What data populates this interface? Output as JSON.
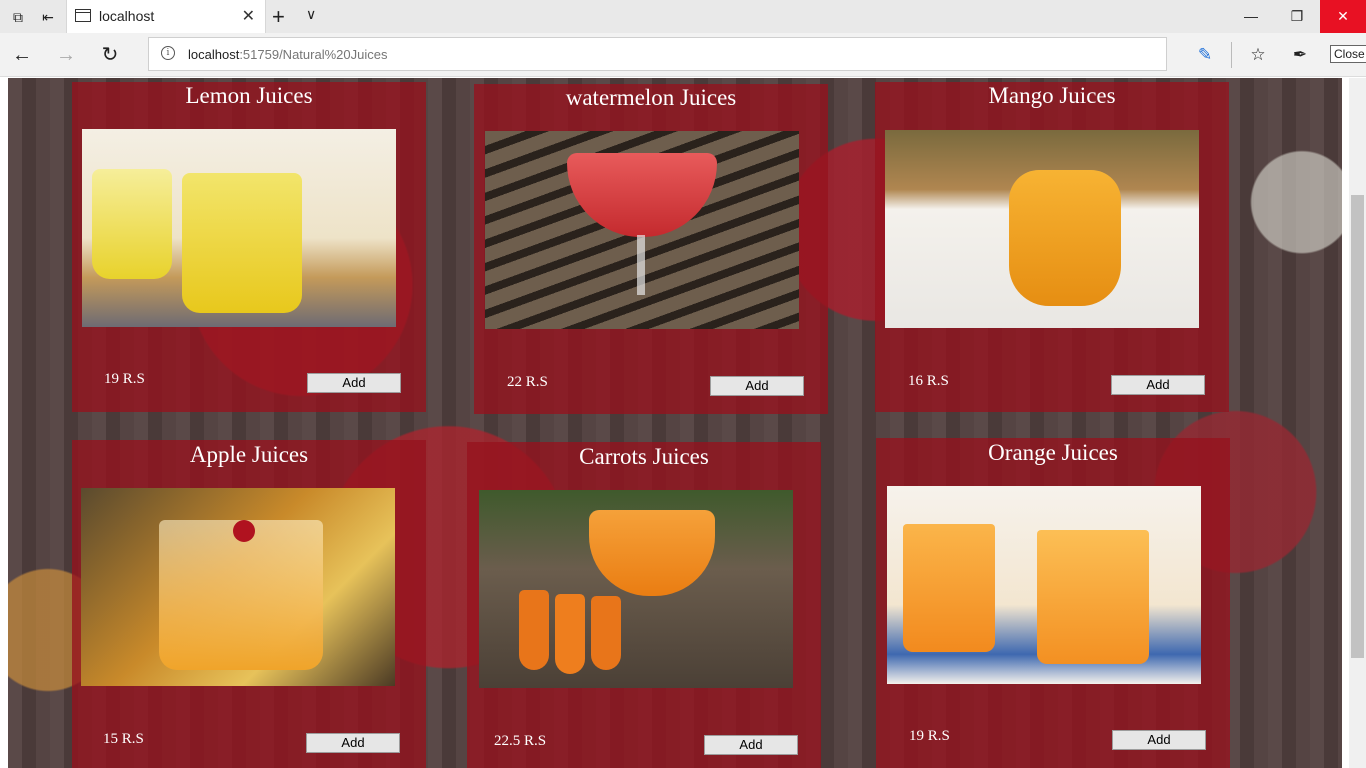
{
  "browser": {
    "tab_title": "localhost",
    "url_host": "localhost",
    "url_path": ":51759/Natural%20Juices",
    "tooltip": "Close"
  },
  "products": [
    {
      "name": "Lemon Juices",
      "price": "19 R.S",
      "button": "Add",
      "image": "lemon-juice-photo"
    },
    {
      "name": "watermelon Juices",
      "price": "22 R.S",
      "button": "Add",
      "image": "watermelon-juice-photo"
    },
    {
      "name": "Mango Juices",
      "price": "16 R.S",
      "button": "Add",
      "image": "mango-juice-photo"
    },
    {
      "name": "Apple Juices",
      "price": "15 R.S",
      "button": "Add",
      "image": "apple-juice-photo"
    },
    {
      "name": "Carrots Juices",
      "price": "22.5 R.S",
      "button": "Add",
      "image": "carrot-juice-photo"
    },
    {
      "name": "Orange Juices",
      "price": "19 R.S",
      "button": "Add",
      "image": "orange-juice-photo"
    }
  ],
  "colors": {
    "card_overlay": "#96121e",
    "close_button": "#e81123"
  }
}
